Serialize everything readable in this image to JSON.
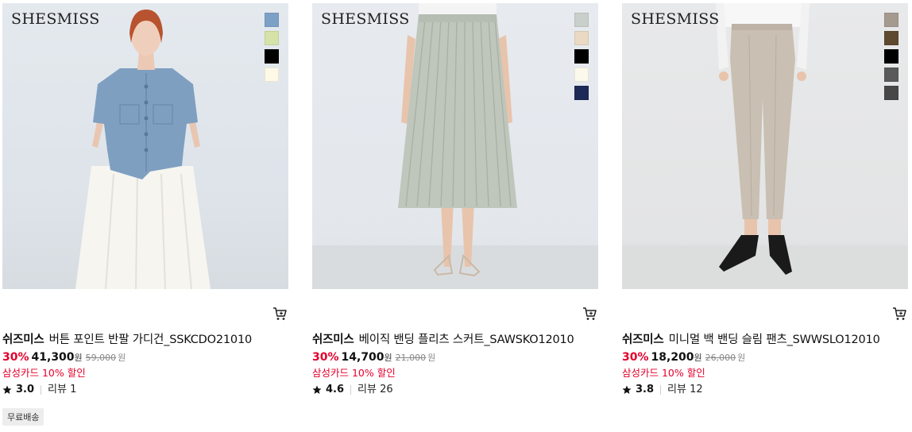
{
  "products": [
    {
      "logo": "SHESMISS",
      "swatches": [
        "#7da0c7",
        "#d5e2a8",
        "#000000",
        "#fdf9e6"
      ],
      "brand": "쉬즈미스",
      "name": "버튼 포인트 반팔 가디건_SSKCDO21010",
      "discount": "30%",
      "price": "41,300",
      "price_unit": "원",
      "original_price": "59,000",
      "original_unit": "원",
      "card_promo": "삼성카드 10% 할인",
      "rating": "3.0",
      "reviews": "리뷰 1"
    },
    {
      "logo": "SHESMISS",
      "swatches": [
        "#c9cfcb",
        "#ead9c3",
        "#000000",
        "#fbf9ec",
        "#1d2a58"
      ],
      "brand": "쉬즈미스",
      "name": "베이직 밴딩 플리츠 스커트_SAWSKO12010",
      "discount": "30%",
      "price": "14,700",
      "price_unit": "원",
      "original_price": "21,000",
      "original_unit": "원",
      "card_promo": "삼성카드 10% 할인",
      "rating": "4.6",
      "reviews": "리뷰 26"
    },
    {
      "logo": "SHESMISS",
      "swatches": [
        "#a49a8f",
        "#5f4a30",
        "#000000",
        "#5a5a5a",
        "#474747"
      ],
      "brand": "쉬즈미스",
      "name": "미니멀 백 밴딩 슬림 팬츠_SWWSLO12010",
      "discount": "30%",
      "price": "18,200",
      "price_unit": "원",
      "original_price": "26,000",
      "original_unit": "원",
      "card_promo": "삼성카드 10% 할인",
      "rating": "3.8",
      "reviews": "리뷰 12"
    }
  ],
  "badge": "무료배송",
  "icons": {
    "cart": "cart-icon",
    "star": "star-icon"
  },
  "colors": {
    "discount": "#e4002b",
    "badge_bg": "#ededed"
  }
}
